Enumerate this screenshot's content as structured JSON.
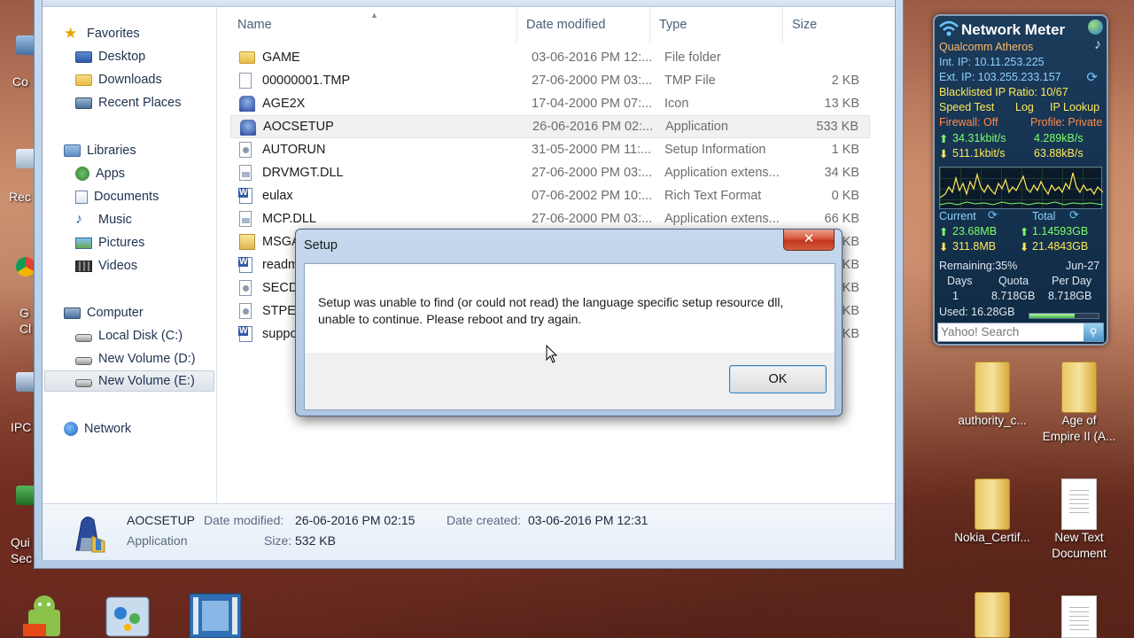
{
  "desktop_left": {
    "labels": [
      "Co",
      "Rec",
      "G",
      "Cl",
      "IPC",
      "Qui",
      "Sec"
    ]
  },
  "nav": {
    "favorites": "Favorites",
    "desktop": "Desktop",
    "downloads": "Downloads",
    "recent_places": "Recent Places",
    "libraries": "Libraries",
    "apps": "Apps",
    "documents": "Documents",
    "music": "Music",
    "pictures": "Pictures",
    "videos": "Videos",
    "computer": "Computer",
    "local_c": "Local Disk (C:)",
    "vol_d": "New Volume (D:)",
    "vol_e": "New Volume (E:)",
    "network": "Network"
  },
  "columns": {
    "name": "Name",
    "date": "Date modified",
    "type": "Type",
    "size": "Size"
  },
  "files": [
    {
      "name": "GAME",
      "date": "03-06-2016 PM 12:...",
      "type": "File folder",
      "size": ""
    },
    {
      "name": "00000001.TMP",
      "date": "27-06-2000 PM 03:...",
      "type": "TMP File",
      "size": "2 KB"
    },
    {
      "name": "AGE2X",
      "date": "17-04-2000 PM 07:...",
      "type": "Icon",
      "size": "13 KB"
    },
    {
      "name": "AOCSETUP",
      "date": "26-06-2016 PM 02:...",
      "type": "Application",
      "size": "533 KB"
    },
    {
      "name": "AUTORUN",
      "date": "31-05-2000 PM 11:...",
      "type": "Setup Information",
      "size": "1 KB"
    },
    {
      "name": "DRVMGT.DLL",
      "date": "27-06-2000 PM 03:...",
      "type": "Application extens...",
      "size": "34 KB"
    },
    {
      "name": "eulax",
      "date": "07-06-2002 PM 10:...",
      "type": "Rich Text Format",
      "size": "0 KB"
    },
    {
      "name": "MCP.DLL",
      "date": "27-06-2000 PM 03:...",
      "type": "Application extens...",
      "size": "66 KB"
    },
    {
      "name": "MSGA",
      "date": "",
      "type": "",
      "size": "KB"
    },
    {
      "name": "readm",
      "date": "",
      "type": "",
      "size": "KB"
    },
    {
      "name": "SECDF",
      "date": "",
      "type": "",
      "size": "KB"
    },
    {
      "name": "STPEN",
      "date": "",
      "type": "",
      "size": "KB"
    },
    {
      "name": "suppo",
      "date": "",
      "type": "",
      "size": "KB"
    }
  ],
  "details": {
    "name": "AOCSETUP",
    "kind": "Application",
    "date_modified_label": "Date modified:",
    "date_modified": "26-06-2016 PM 02:15",
    "date_created_label": "Date created:",
    "date_created": "03-06-2016 PM 12:31",
    "size_label": "Size:",
    "size": "532 KB"
  },
  "dialog": {
    "title": "Setup",
    "close": "✕",
    "message": "Setup was unable to find (or could not read) the language specific setup resource dll, unable to continue.  Please reboot and try again.",
    "ok": "OK"
  },
  "network_meter": {
    "title": "Network Meter",
    "adapter": "Qualcomm Atheros",
    "int_ip": "Int. IP: 10.11.253.225",
    "ext_ip": "Ext. IP: 103.255.233.157",
    "blacklist": "Blacklisted IP Ratio: 10/67",
    "speed_test": "Speed Test",
    "log": "Log",
    "ip_lookup": "IP Lookup",
    "firewall": "Firewall: Off",
    "profile": "Profile: Private",
    "up_kbit": "34.31kbit/s",
    "up_kb": "4.289kB/s",
    "down_kbit": "511.1kbit/s",
    "down_kb": "63.88kB/s",
    "current": "Current",
    "total": "Total",
    "cur_up": "23.68MB",
    "tot_up": "1.14593GB",
    "cur_down": "311.8MB",
    "tot_down": "21.4843GB",
    "remaining": "Remaining:35%",
    "date": "Jun-27",
    "days_lbl": "Days",
    "quota_lbl": "Quota",
    "perday_lbl": "Per Day",
    "days": "1",
    "quota": "8.718GB",
    "perday": "8.718GB",
    "used": "Used: 16.28GB",
    "used_fraction": 0.65,
    "search_placeholder": "Yahoo! Search",
    "colors": {
      "green": "#7dff6a",
      "blue": "#6ec4ff",
      "orange": "#ff9b3d",
      "yellow": "#ffe95a",
      "red": "#ff6a4a"
    }
  },
  "desktop_icons": {
    "authority": "authority_c...",
    "age_line1": "Age of",
    "age_line2": "Empire II (A...",
    "nokia": "Nokia_Certif...",
    "newtext_line1": "New Text",
    "newtext_line2": "Document"
  }
}
